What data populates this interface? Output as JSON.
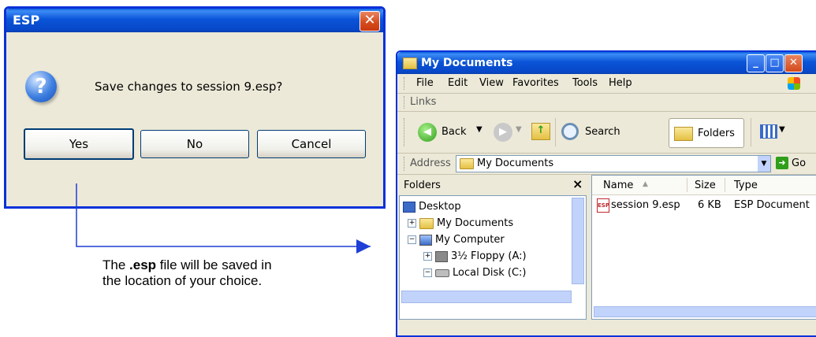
{
  "dialog": {
    "title": "ESP",
    "close_glyph": "✕",
    "icon": "question-icon",
    "icon_glyph": "?",
    "message": "Save changes to session 9.esp?",
    "buttons": {
      "yes": "Yes",
      "no": "No",
      "cancel": "Cancel"
    }
  },
  "caption": {
    "ext": ".esp",
    "line1_before": "The ",
    "line1_after": " file will be saved in",
    "line2": "the location of your choice."
  },
  "explorer": {
    "title": "My Documents",
    "menu": [
      "File",
      "Edit",
      "View",
      "Favorites",
      "Tools",
      "Help"
    ],
    "links_label": "Links",
    "toolbar": {
      "back": "Back",
      "search": "Search",
      "folders": "Folders"
    },
    "address_label": "Address",
    "address_value": "My Documents",
    "go_label": "Go",
    "folders_pane": {
      "header": "Folders",
      "close_glyph": "×",
      "tree": [
        "Desktop",
        "My Documents",
        "My Computer",
        "3½ Floppy (A:)",
        "Local Disk (C:)"
      ]
    },
    "file_list": {
      "columns": {
        "name": "Name",
        "size": "Size",
        "type": "Type"
      },
      "rows": [
        {
          "name": "session 9.esp",
          "size": "6 KB",
          "type": "ESP Document"
        }
      ],
      "icon_label": "ESP"
    }
  },
  "colors": {
    "title_blue": "#0a54d8",
    "close_red": "#d44a1b",
    "connector_blue": "#1f3fd6",
    "dialog_bg": "#ece9d8"
  }
}
